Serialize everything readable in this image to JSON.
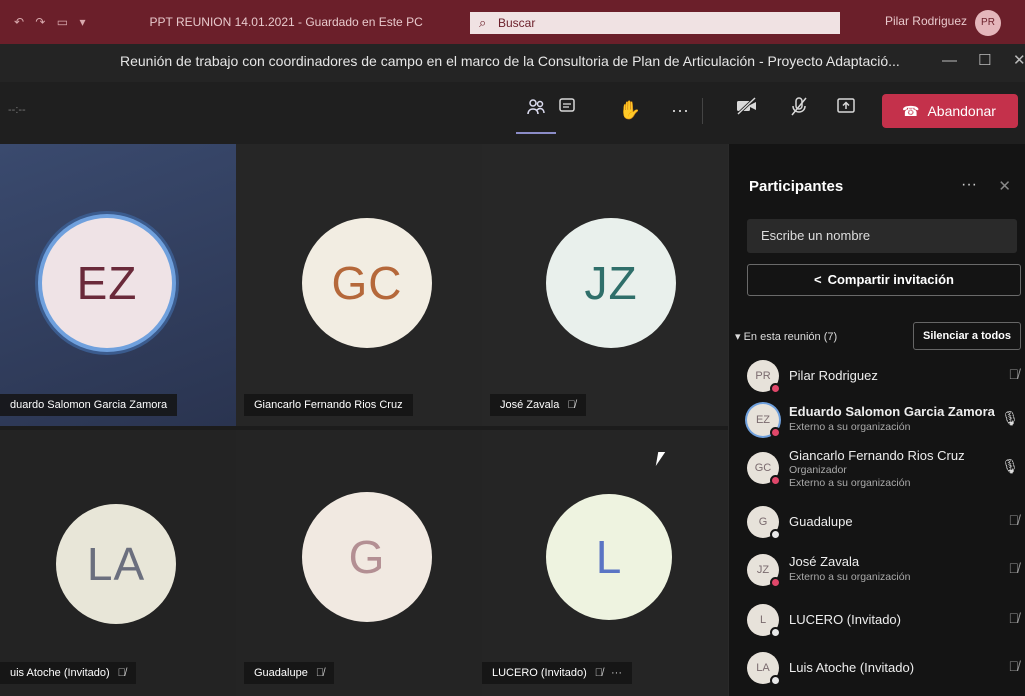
{
  "office": {
    "doc_title": "PPT REUNION 14.01.2021 - Guardado en Este PC",
    "search_placeholder": "Buscar",
    "user_name": "Pilar Rodriguez",
    "user_initials": "PR"
  },
  "window": {
    "meeting_title": "Reunión de trabajo con coordinadores de campo en el marco de la Consultoria de Plan de Articulación - Proyecto Adaptació..."
  },
  "toolbar": {
    "leave_label": "Abandonar"
  },
  "tiles": [
    {
      "initials": "EZ",
      "name": "duardo Salomon Garcia Zamora",
      "muted": false
    },
    {
      "initials": "GC",
      "name": "Giancarlo Fernando Rios Cruz",
      "muted": false
    },
    {
      "initials": "JZ",
      "name": "José Zavala",
      "muted": true
    },
    {
      "initials": "LA",
      "name": "uis Atoche (Invitado)",
      "muted": true
    },
    {
      "initials": "G",
      "name": "Guadalupe",
      "muted": true
    },
    {
      "initials": "L",
      "name": "LUCERO (Invitado)",
      "muted": true
    }
  ],
  "panel": {
    "title": "Participantes",
    "search_placeholder": "Escribe un nombre",
    "invite_label": "Compartir invitación",
    "section_label": "En esta reunión (7)",
    "mute_all_label": "Silenciar a todos",
    "participants": [
      {
        "initials": "PR",
        "name": "Pilar Rodriguez",
        "sub1": "",
        "sub2": ""
      },
      {
        "initials": "EZ",
        "name": "Eduardo Salomon Garcia Zamora",
        "sub1": "Externo a su organización",
        "sub2": ""
      },
      {
        "initials": "GC",
        "name": "Giancarlo Fernando Rios Cruz",
        "sub1": "Organizador",
        "sub2": "Externo a su organización"
      },
      {
        "initials": "G",
        "name": "Guadalupe",
        "sub1": "",
        "sub2": ""
      },
      {
        "initials": "JZ",
        "name": "José Zavala",
        "sub1": "Externo a su organización",
        "sub2": ""
      },
      {
        "initials": "L",
        "name": "LUCERO (Invitado)",
        "sub1": "",
        "sub2": ""
      },
      {
        "initials": "LA",
        "name": "Luis Atoche (Invitado)",
        "sub1": "",
        "sub2": ""
      }
    ]
  },
  "colors": {
    "leave": "#c4314b",
    "office_bar": "#6b1f2a",
    "active": "#8b8cc7"
  }
}
